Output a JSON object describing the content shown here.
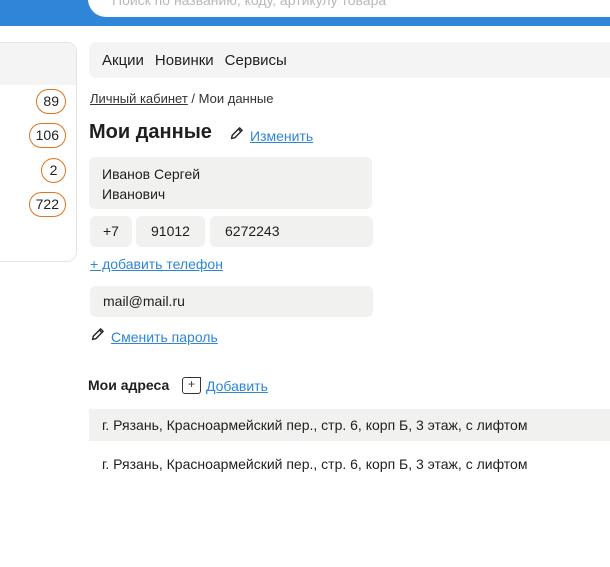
{
  "header": {
    "search_placeholder": "Поиск по названию, коду, артикулу товара"
  },
  "sidebar": {
    "counts": [
      "89",
      "106",
      "2",
      "722"
    ]
  },
  "nav": {
    "items": [
      "Акции",
      "Новинки",
      "Сервисы"
    ]
  },
  "breadcrumb": {
    "parent": "Личный кабинет",
    "separator": " / ",
    "current": "Мои данные"
  },
  "profile": {
    "title": "Мои данные",
    "edit_label": "Изменить",
    "name_line1": "Иванов Сергей",
    "name_line2": "Иванович",
    "phone_code": "+7",
    "phone_area": "91012",
    "phone_number": "6272243",
    "add_phone_label": "+ добавить телефон",
    "email": "mail@mail.ru",
    "change_password_label": "Сменить пароль"
  },
  "addresses": {
    "title": "Мои адреса",
    "add_label": "Добавить",
    "plus_glyph": "+",
    "items": [
      "г. Рязань, Красноармейский пер., стр. 6, корп Б,  3 этаж, с лифтом",
      "г. Рязань, Красноармейский пер., стр. 6, корп Б,  3 этаж, с лифтом"
    ]
  },
  "colors": {
    "accent": "#2f86d8",
    "badge_border": "#e0741f",
    "field_bg": "#f1f1f0"
  }
}
